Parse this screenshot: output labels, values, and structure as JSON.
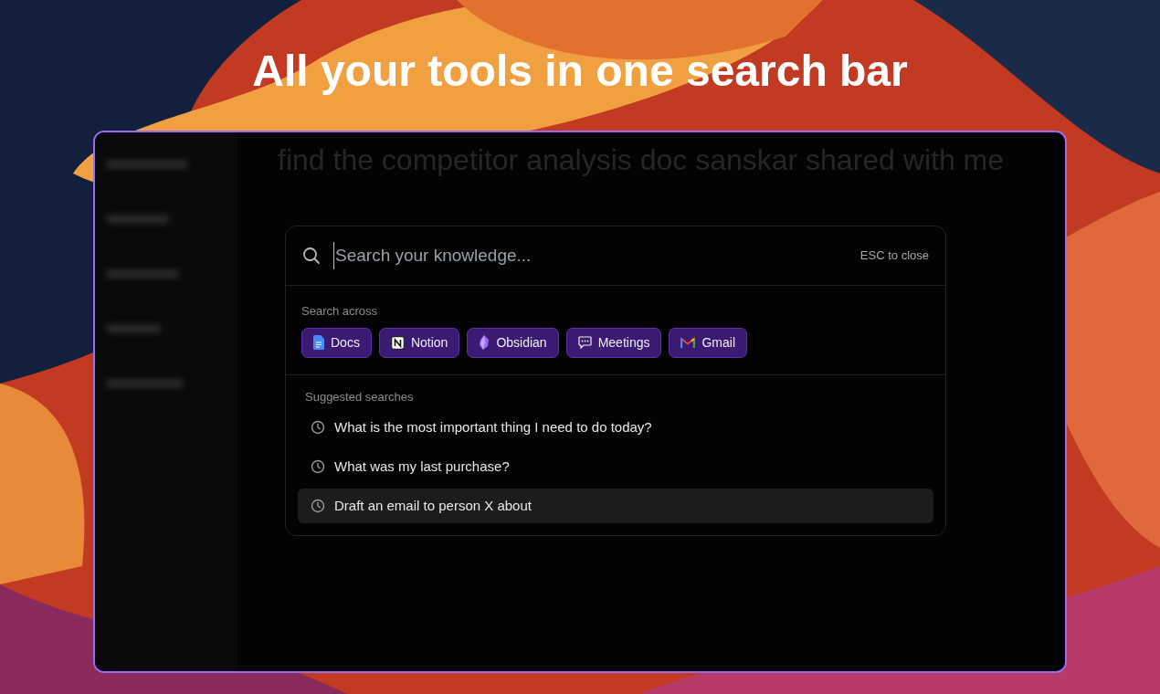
{
  "headline": "All your tools in one search bar",
  "app": {
    "background_heading": "find the competitor analysis doc sanskar shared with me"
  },
  "palette": {
    "search": {
      "placeholder": "Search your knowledge..."
    },
    "close_hint": "ESC to close",
    "sources_label": "Search across",
    "sources": [
      {
        "label": "Docs",
        "kind": "docs"
      },
      {
        "label": "Notion",
        "kind": "notion"
      },
      {
        "label": "Obsidian",
        "kind": "obsidian"
      },
      {
        "label": "Meetings",
        "kind": "meetings"
      },
      {
        "label": "Gmail",
        "kind": "gmail"
      }
    ],
    "suggestions_label": "Suggested searches",
    "suggestions": [
      {
        "text": "What is the most important thing I need to do today?",
        "selected": false
      },
      {
        "text": "What was my last purchase?",
        "selected": false
      },
      {
        "text": "Draft an email to person X about",
        "selected": true
      }
    ]
  }
}
